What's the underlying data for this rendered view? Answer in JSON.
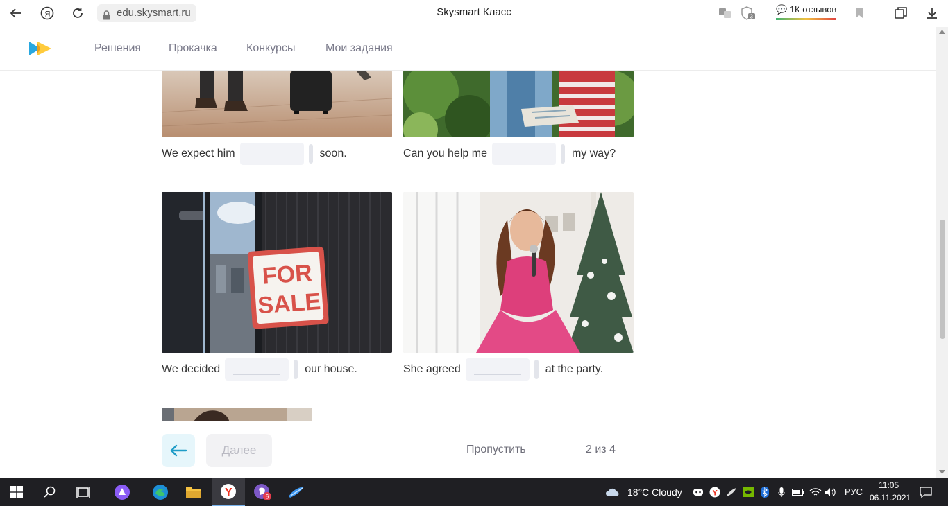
{
  "browser": {
    "url": "edu.skysmart.ru",
    "title": "Skysmart Класс",
    "reviews": "1К отзывов",
    "tab_badge": "3"
  },
  "site": {
    "menu": [
      "Решения",
      "Прокачка",
      "Конкурсы",
      "Мои задания"
    ],
    "brand_colors": {
      "blue": "#29a8e0",
      "yellow": "#ffc832"
    }
  },
  "exercise": {
    "items": [
      {
        "before": "We expect him",
        "after": "soon.",
        "answer": ""
      },
      {
        "before": "Can you help me",
        "after": "my way?",
        "answer": ""
      },
      {
        "before": "We decided",
        "after": "our house.",
        "answer": ""
      },
      {
        "before": "She agreed",
        "after": "at the party.",
        "answer": ""
      }
    ],
    "sign_line1": "FOR",
    "sign_line2": "SALE"
  },
  "footer": {
    "next_label": "Далее",
    "skip_label": "Пропустить",
    "progress": "2 из 4"
  },
  "taskbar": {
    "weather": "18°C  Cloudy",
    "language": "РУС",
    "time": "11:05",
    "date": "06.11.2021",
    "viber_badge": "6"
  }
}
